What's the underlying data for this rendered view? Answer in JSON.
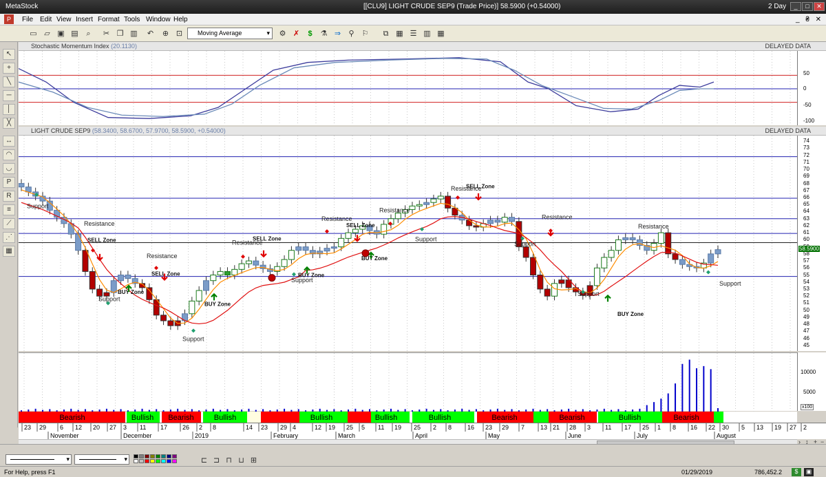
{
  "window": {
    "app_name": "MetaStock",
    "title": "[[CLU9] LIGHT CRUDE SEP9 (Trade Price)]   58.5900 (+0.54000)",
    "period": "2 Day",
    "min_btn": "_",
    "max_btn": "□",
    "close_btn": "✕"
  },
  "menu": [
    "File",
    "Edit",
    "View",
    "Insert",
    "Format",
    "Tools",
    "Window",
    "Help"
  ],
  "menu_right": "_ ₴ ✕",
  "toolbar": {
    "indicator_select": "Moving Average"
  },
  "stoch_pane": {
    "title": "Stochastic Momentum Index",
    "value": "(20.1130)",
    "delayed": "DELAYED DATA",
    "ticks": [
      "50",
      "0",
      "-50",
      "-100"
    ]
  },
  "price_pane": {
    "title": "LIGHT CRUDE SEP9",
    "values": "(58.3400, 58.6700, 57.9700, 58.5900, +0.54000)",
    "delayed": "DELAYED DATA",
    "ticks": [
      "74",
      "73",
      "72",
      "71",
      "70",
      "69",
      "68",
      "67",
      "66",
      "65",
      "64",
      "63",
      "62",
      "61",
      "60",
      "59",
      "58",
      "57",
      "56",
      "55",
      "54",
      "53",
      "52",
      "51",
      "50",
      "49",
      "48",
      "47",
      "46",
      "45"
    ],
    "last_price": "58.5900"
  },
  "volume_pane": {
    "ticks": [
      "10000",
      "5000"
    ],
    "multiplier": "x100"
  },
  "annotations": {
    "resistance": "Resistance",
    "support": "Support",
    "buy_zone": "BUY Zone",
    "sell_zone": "SELL Zone",
    "stop": "Stop"
  },
  "trend_bar": [
    {
      "label": "Bearish",
      "color": "#ff0000"
    },
    {
      "label": "Bullish",
      "color": "#00ff00"
    },
    {
      "label": "Bearish",
      "color": "#ff0000"
    },
    {
      "label": "Bullish",
      "color": "#00ff00"
    },
    {
      "label": "Bullish",
      "color": "#00ff00"
    },
    {
      "label": "Bullish",
      "color": "#00ff00"
    },
    {
      "label": "Bullish",
      "color": "#00ff00"
    },
    {
      "label": "Bearish",
      "color": "#ff0000"
    },
    {
      "label": "Bearish",
      "color": "#ff0000"
    },
    {
      "label": "Bullish",
      "color": "#00ff00"
    },
    {
      "label": "Bearish",
      "color": "#ff0000"
    }
  ],
  "date_axis": {
    "days": [
      "23",
      "29",
      "6",
      "12",
      "20",
      "27",
      "3",
      "11",
      "17",
      "26",
      "2",
      "8",
      "14",
      "23",
      "29",
      "4",
      "12",
      "19",
      "25",
      "5",
      "11",
      "19",
      "25",
      "2",
      "8",
      "16",
      "23",
      "29",
      "7",
      "13",
      "21",
      "28",
      "3",
      "11",
      "17",
      "25",
      "1",
      "8",
      "16",
      "22",
      "30",
      "5",
      "13",
      "19",
      "27",
      "2"
    ],
    "months": [
      "November",
      "December",
      "2019",
      "February",
      "March",
      "April",
      "May",
      "June",
      "July",
      "August"
    ]
  },
  "status": {
    "help": "For Help, press F1",
    "date": "01/29/2019",
    "coord": "786,452.2"
  },
  "colors": {
    "bull_candle": "#2e9e2e",
    "bear_candle": "#b30000",
    "neutral_candle": "#7b9cc8",
    "ma_fast": "#ff8c00",
    "ma_slow": "#e01010",
    "h_line": "#2020b0",
    "stoch_fast": "#3c3c9c",
    "stoch_slow": "#6a8ab8",
    "volume": "#0000cc"
  }
}
